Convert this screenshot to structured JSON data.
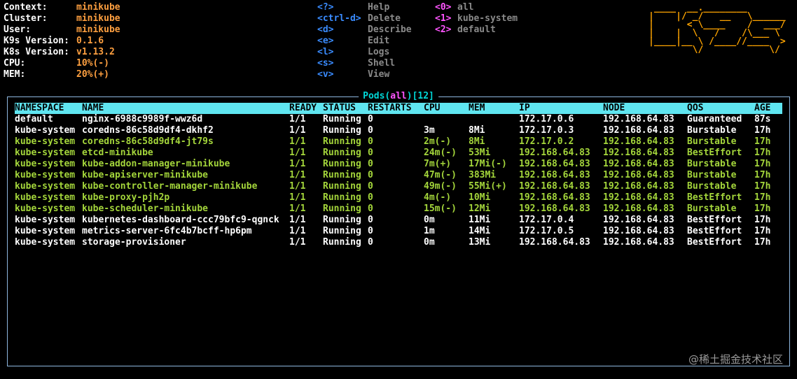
{
  "info": [
    {
      "label": "Context:",
      "value": "minikube"
    },
    {
      "label": "Cluster:",
      "value": "minikube"
    },
    {
      "label": "User:",
      "value": "minikube"
    },
    {
      "label": "K9s Version:",
      "value": "0.1.6"
    },
    {
      "label": "K8s Version:",
      "value": "v1.13.2"
    },
    {
      "label": "CPU:",
      "value": "10%(-)"
    },
    {
      "label": "MEM:",
      "value": "20%(+)"
    }
  ],
  "shortcuts": [
    {
      "key": "<?>",
      "action": "Help"
    },
    {
      "key": "<ctrl-d>",
      "action": "Delete"
    },
    {
      "key": "<d>",
      "action": "Describe"
    },
    {
      "key": "<e>",
      "action": "Edit"
    },
    {
      "key": "<l>",
      "action": "Logs"
    },
    {
      "key": "<s>",
      "action": "Shell"
    },
    {
      "key": "<v>",
      "action": "View"
    }
  ],
  "namespaces": [
    {
      "key": "<0>",
      "name": "all"
    },
    {
      "key": "<1>",
      "name": "kube-system"
    },
    {
      "key": "<2>",
      "name": "default"
    }
  ],
  "logo": " ____  __.________       \n|    |/ _/   __   \\______\n|      < \\____    /  ___/\n|    |  \\   /    /\\___ \\ \n|____|__ \\ /____//____  >\n        \\/            \\/ ",
  "frame": {
    "title": "Pods",
    "filter": "all",
    "count": "12"
  },
  "table": {
    "headers": [
      "NAMESPACE",
      "NAME",
      "READY",
      "STATUS",
      "RESTARTS",
      "CPU",
      "MEM",
      "IP",
      "NODE",
      "QOS",
      "AGE"
    ],
    "rows": [
      {
        "style": "white",
        "cells": [
          "default",
          "nginx-6988c9989f-wwz6d",
          "1/1",
          "Running",
          "0",
          "",
          "",
          "172.17.0.6",
          "192.168.64.83",
          "Guaranteed",
          "87s"
        ]
      },
      {
        "style": "white",
        "cells": [
          "kube-system",
          "coredns-86c58d9df4-dkhf2",
          "1/1",
          "Running",
          "0",
          "3m",
          "8Mi",
          "172.17.0.3",
          "192.168.64.83",
          "Burstable",
          "17h"
        ]
      },
      {
        "style": "green",
        "cells": [
          "kube-system",
          "coredns-86c58d9df4-jt79s",
          "1/1",
          "Running",
          "0",
          "2m(-)",
          "8Mi",
          "172.17.0.2",
          "192.168.64.83",
          "Burstable",
          "17h"
        ]
      },
      {
        "style": "green",
        "cells": [
          "kube-system",
          "etcd-minikube",
          "1/1",
          "Running",
          "0",
          "24m(-)",
          "53Mi",
          "192.168.64.83",
          "192.168.64.83",
          "BestEffort",
          "17h"
        ]
      },
      {
        "style": "green",
        "cells": [
          "kube-system",
          "kube-addon-manager-minikube",
          "1/1",
          "Running",
          "0",
          "7m(+)",
          "17Mi(-)",
          "192.168.64.83",
          "192.168.64.83",
          "Burstable",
          "17h"
        ]
      },
      {
        "style": "green",
        "cells": [
          "kube-system",
          "kube-apiserver-minikube",
          "1/1",
          "Running",
          "0",
          "47m(-)",
          "383Mi",
          "192.168.64.83",
          "192.168.64.83",
          "Burstable",
          "17h"
        ]
      },
      {
        "style": "green",
        "cells": [
          "kube-system",
          "kube-controller-manager-minikube",
          "1/1",
          "Running",
          "0",
          "49m(-)",
          "55Mi(+)",
          "192.168.64.83",
          "192.168.64.83",
          "Burstable",
          "17h"
        ]
      },
      {
        "style": "green",
        "cells": [
          "kube-system",
          "kube-proxy-pjh2p",
          "1/1",
          "Running",
          "0",
          "4m(-)",
          "10Mi",
          "192.168.64.83",
          "192.168.64.83",
          "BestEffort",
          "17h"
        ]
      },
      {
        "style": "green",
        "cells": [
          "kube-system",
          "kube-scheduler-minikube",
          "1/1",
          "Running",
          "0",
          "15m(-)",
          "12Mi",
          "192.168.64.83",
          "192.168.64.83",
          "Burstable",
          "17h"
        ]
      },
      {
        "style": "white",
        "cells": [
          "kube-system",
          "kubernetes-dashboard-ccc79bfc9-qgnck",
          "1/1",
          "Running",
          "0",
          "0m",
          "11Mi",
          "172.17.0.4",
          "192.168.64.83",
          "BestEffort",
          "17h"
        ]
      },
      {
        "style": "white",
        "cells": [
          "kube-system",
          "metrics-server-6fc4b7bcff-hp6pm",
          "1/1",
          "Running",
          "0",
          "1m",
          "14Mi",
          "172.17.0.5",
          "192.168.64.83",
          "BestEffort",
          "17h"
        ]
      },
      {
        "style": "white",
        "cells": [
          "kube-system",
          "storage-provisioner",
          "1/1",
          "Running",
          "0",
          "0m",
          "13Mi",
          "192.168.64.83",
          "192.168.64.83",
          "BestEffort",
          "17h"
        ]
      }
    ]
  },
  "watermark": "@稀土掘金技术社区",
  "colors": {
    "header_bg": "#5fe5f0",
    "healthy": "#a4d63b",
    "accent": "#ffa040"
  }
}
